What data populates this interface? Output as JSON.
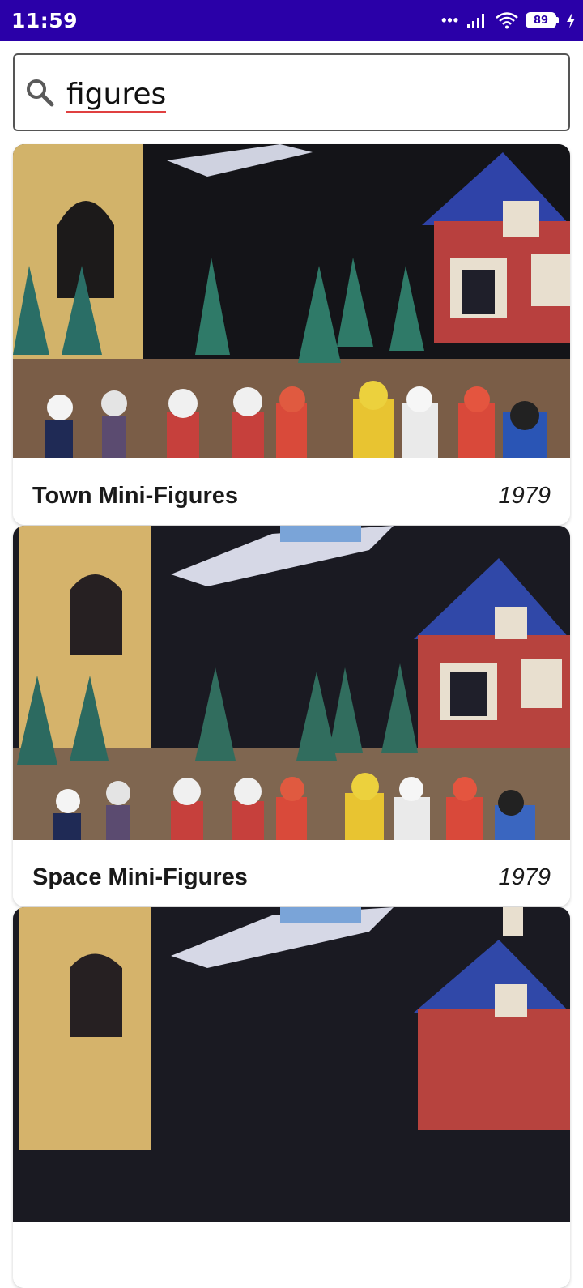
{
  "status_bar": {
    "time": "11:59",
    "battery": "89",
    "icons": [
      "dots-icon",
      "signal-icon",
      "wifi-icon",
      "battery-icon",
      "charging-icon"
    ]
  },
  "search": {
    "value": "figures",
    "icon": "search-icon"
  },
  "results": [
    {
      "title": "Town Mini-Figures",
      "year": "1979"
    },
    {
      "title": "Space Mini-Figures",
      "year": "1979"
    },
    {
      "title": "",
      "year": ""
    }
  ],
  "colors": {
    "status_bar": "#2a00a8",
    "spellcheck_underline": "#e04040"
  }
}
